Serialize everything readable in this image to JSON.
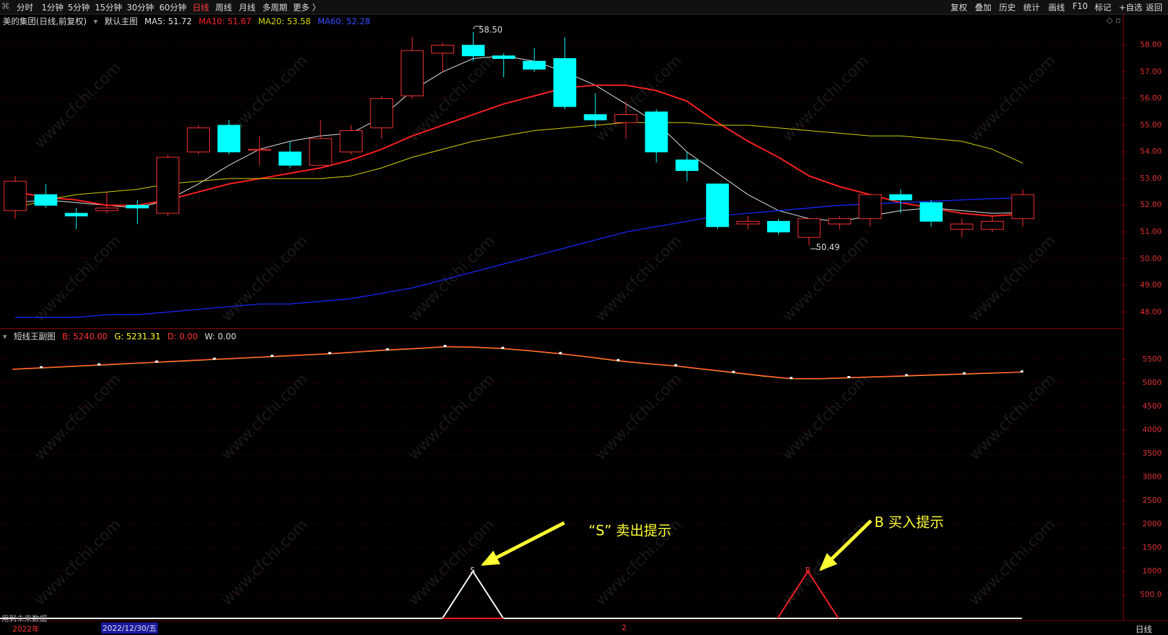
{
  "toolbar": {
    "left": [
      "分时",
      "1分钟",
      "5分钟",
      "15分钟",
      "30分钟",
      "60分钟",
      "日线",
      "周线",
      "月线",
      "多周期",
      "更多 〉"
    ],
    "active": "日线",
    "right": [
      "复权",
      "叠加",
      "历史",
      "统计",
      "画线",
      "F10",
      "标记",
      "+自选",
      "返回"
    ]
  },
  "main_legend": {
    "stock": "美的集团(日线,前复权)",
    "template": "默认主图",
    "ma5": "MA5: 51.72",
    "ma10": "MA10: 51.67",
    "ma20": "MA20: 53.58",
    "ma60": "MA60: 52.28"
  },
  "sub_legend": {
    "name": "短线王副图",
    "b": "B: 5240.00",
    "g": "G: 5231.31",
    "d": "D: 0.00",
    "w": "W: 0.00"
  },
  "annotations": {
    "high": "58.50",
    "low": "50.49",
    "sell": "“S”  卖出提示",
    "buy": "B  买入提示",
    "sell_marker": "S",
    "buy_marker": "B"
  },
  "bottom_bar": {
    "note": "用到未来数据",
    "year": "2022年",
    "date": "2022/12/30/五",
    "month": "2",
    "period": "日线"
  },
  "watermark": "www.cfchi.com",
  "colors": {
    "up": "#ff3232",
    "down": "#00ffff",
    "ma5": "#e6e6e6",
    "ma10": "#ff2020",
    "ma20": "#d7d700",
    "ma60": "#1428ff"
  },
  "chart_data": [
    {
      "type": "candlestick",
      "ylim": [
        47.6,
        58.5
      ],
      "yticks": [
        48.0,
        49.0,
        50.0,
        51.0,
        52.0,
        53.0,
        54.0,
        55.0,
        56.0,
        57.0,
        58.0
      ],
      "candles": [
        {
          "o": 51.8,
          "h": 53.1,
          "l": 51.5,
          "c": 52.9
        },
        {
          "o": 52.4,
          "h": 52.8,
          "l": 51.9,
          "c": 52.0
        },
        {
          "o": 51.7,
          "h": 51.9,
          "l": 51.1,
          "c": 51.6
        },
        {
          "o": 51.8,
          "h": 52.5,
          "l": 51.7,
          "c": 51.9
        },
        {
          "o": 52.0,
          "h": 52.2,
          "l": 51.3,
          "c": 51.9
        },
        {
          "o": 51.7,
          "h": 53.9,
          "l": 51.6,
          "c": 53.8
        },
        {
          "o": 54.0,
          "h": 55.0,
          "l": 53.9,
          "c": 54.9
        },
        {
          "o": 55.0,
          "h": 55.2,
          "l": 53.9,
          "c": 54.0
        },
        {
          "o": 54.1,
          "h": 54.6,
          "l": 53.5,
          "c": 54.1
        },
        {
          "o": 54.0,
          "h": 54.4,
          "l": 53.4,
          "c": 53.5
        },
        {
          "o": 53.5,
          "h": 55.2,
          "l": 53.5,
          "c": 54.5
        },
        {
          "o": 54.0,
          "h": 55.0,
          "l": 53.9,
          "c": 54.8
        },
        {
          "o": 54.9,
          "h": 56.1,
          "l": 54.5,
          "c": 56.0
        },
        {
          "o": 56.1,
          "h": 58.3,
          "l": 56.0,
          "c": 57.8
        },
        {
          "o": 57.7,
          "h": 58.1,
          "l": 57.0,
          "c": 58.0
        },
        {
          "o": 58.0,
          "h": 58.5,
          "l": 57.4,
          "c": 57.6
        },
        {
          "o": 57.6,
          "h": 57.7,
          "l": 56.8,
          "c": 57.5
        },
        {
          "o": 57.4,
          "h": 57.9,
          "l": 57.0,
          "c": 57.1
        },
        {
          "o": 57.5,
          "h": 58.3,
          "l": 55.6,
          "c": 55.7
        },
        {
          "o": 55.4,
          "h": 56.2,
          "l": 54.9,
          "c": 55.2
        },
        {
          "o": 55.1,
          "h": 55.9,
          "l": 54.5,
          "c": 55.4
        },
        {
          "o": 55.5,
          "h": 55.6,
          "l": 53.6,
          "c": 54.0
        },
        {
          "o": 53.7,
          "h": 54.0,
          "l": 52.9,
          "c": 53.3
        },
        {
          "o": 52.8,
          "h": 52.8,
          "l": 51.1,
          "c": 51.2
        },
        {
          "o": 51.3,
          "h": 51.6,
          "l": 51.1,
          "c": 51.4
        },
        {
          "o": 51.4,
          "h": 51.5,
          "l": 50.9,
          "c": 51.0
        },
        {
          "o": 50.8,
          "h": 51.5,
          "l": 50.5,
          "c": 51.5
        },
        {
          "o": 51.3,
          "h": 51.6,
          "l": 51.1,
          "c": 51.5
        },
        {
          "o": 51.5,
          "h": 52.4,
          "l": 51.2,
          "c": 52.4
        },
        {
          "o": 52.4,
          "h": 52.6,
          "l": 51.7,
          "c": 52.2
        },
        {
          "o": 52.1,
          "h": 52.2,
          "l": 51.2,
          "c": 51.4
        },
        {
          "o": 51.1,
          "h": 51.5,
          "l": 50.8,
          "c": 51.3
        },
        {
          "o": 51.1,
          "h": 51.6,
          "l": 51.0,
          "c": 51.4
        },
        {
          "o": 51.5,
          "h": 52.6,
          "l": 51.2,
          "c": 52.4
        }
      ],
      "series": [
        {
          "name": "MA5",
          "values": [
            52.1,
            52.2,
            52.1,
            52.0,
            51.9,
            52.2,
            52.8,
            53.5,
            54.1,
            54.4,
            54.6,
            54.7,
            55.3,
            56.3,
            57.0,
            57.5,
            57.6,
            57.4,
            57.0,
            56.5,
            55.8,
            55.1,
            54.0,
            53.2,
            52.4,
            51.8,
            51.5,
            51.4,
            51.6,
            51.8,
            51.9,
            51.8,
            51.7,
            51.72
          ]
        },
        {
          "name": "MA10",
          "values": [
            52.5,
            52.3,
            52.2,
            52.0,
            52.0,
            52.2,
            52.5,
            52.8,
            53.0,
            53.2,
            53.4,
            53.7,
            54.1,
            54.6,
            55.0,
            55.4,
            55.8,
            56.1,
            56.4,
            56.5,
            56.5,
            56.3,
            55.9,
            55.1,
            54.4,
            53.8,
            53.1,
            52.7,
            52.4,
            52.1,
            51.9,
            51.7,
            51.6,
            51.67
          ]
        },
        {
          "name": "MA20",
          "values": [
            51.9,
            52.2,
            52.4,
            52.5,
            52.6,
            52.8,
            52.9,
            53.0,
            53.0,
            53.0,
            53.0,
            53.1,
            53.4,
            53.8,
            54.1,
            54.4,
            54.6,
            54.8,
            54.9,
            55.0,
            55.1,
            55.1,
            55.1,
            55.0,
            55.0,
            54.9,
            54.8,
            54.7,
            54.6,
            54.6,
            54.5,
            54.4,
            54.1,
            53.58
          ]
        },
        {
          "name": "MA60",
          "values": [
            47.8,
            47.8,
            47.8,
            47.9,
            47.9,
            48.0,
            48.1,
            48.2,
            48.3,
            48.3,
            48.4,
            48.5,
            48.7,
            48.9,
            49.2,
            49.5,
            49.8,
            50.1,
            50.4,
            50.7,
            51.0,
            51.2,
            51.4,
            51.6,
            51.7,
            51.8,
            51.9,
            52.0,
            52.05,
            52.1,
            52.15,
            52.2,
            52.25,
            52.28
          ]
        }
      ]
    },
    {
      "type": "line",
      "ylim": [
        0,
        5900
      ],
      "yticks": [
        500,
        1000,
        1500,
        2000,
        2500,
        3000,
        3500,
        4000,
        4500,
        5000,
        5500
      ],
      "ytick_labels": [
        "500.0",
        "1000",
        "1500",
        "2000",
        "2500",
        "3000",
        "3500",
        "4000",
        "4500",
        "5000",
        "5500"
      ],
      "series": [
        {
          "name": "B",
          "values": [
            5300,
            5330,
            5360,
            5390,
            5420,
            5450,
            5480,
            5510,
            5540,
            5570,
            5600,
            5630,
            5670,
            5710,
            5740,
            5780,
            5770,
            5740,
            5690,
            5630,
            5560,
            5480,
            5420,
            5370,
            5300,
            5230,
            5160,
            5100,
            5100,
            5120,
            5140,
            5160,
            5180,
            5200,
            5220,
            5240
          ]
        },
        {
          "name": "G",
          "values": [
            5290,
            5320,
            5350,
            5380,
            5410,
            5440,
            5470,
            5500,
            5530,
            5560,
            5590,
            5620,
            5660,
            5700,
            5730,
            5770,
            5760,
            5730,
            5680,
            5620,
            5550,
            5470,
            5410,
            5360,
            5290,
            5220,
            5150,
            5090,
            5090,
            5110,
            5130,
            5150,
            5170,
            5190,
            5210,
            5231.31
          ]
        }
      ],
      "signals": [
        {
          "label": "S",
          "value": 1000,
          "color": "#ffffff"
        },
        {
          "label": "B",
          "value": 1000,
          "color": "#ff2020"
        }
      ]
    }
  ]
}
